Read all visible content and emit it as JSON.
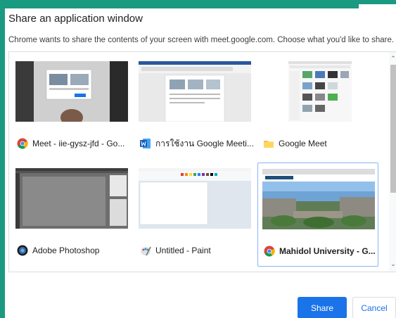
{
  "dialog": {
    "title": "Share an application window",
    "subtitle": "Chrome wants to share the contents of your screen with meet.google.com. Choose what you'd like to share."
  },
  "windows": [
    {
      "label": "Meet - iie-gysz-jfd - Go...",
      "icon": "chrome-icon"
    },
    {
      "label": "การใช้งาน Google Meeti...",
      "icon": "word-icon"
    },
    {
      "label": "Google Meet",
      "icon": "folder-icon"
    },
    {
      "label": "Adobe Photoshop",
      "icon": "photoshop-icon"
    },
    {
      "label": "Untitled - Paint",
      "icon": "paint-icon"
    },
    {
      "label": "Mahidol University - G...",
      "icon": "chrome-icon",
      "selected": true
    }
  ],
  "buttons": {
    "share": "Share",
    "cancel": "Cancel"
  },
  "colors": {
    "accent_frame": "#1a9a80",
    "primary": "#1a73e8",
    "selection_border": "#8ab4f8"
  }
}
